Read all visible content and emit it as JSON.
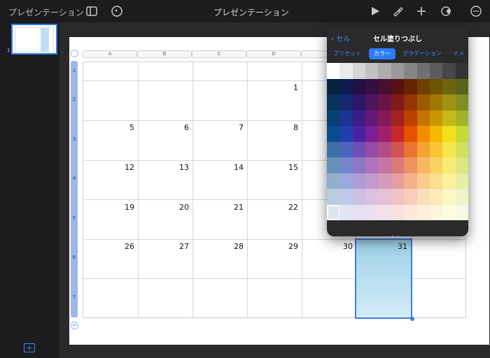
{
  "topbar": {
    "doc_title_left": "プレゼンテーション",
    "doc_title_center": "プレゼンテーション"
  },
  "sidebar": {
    "slide_number": "1",
    "add_label": "+"
  },
  "table": {
    "col_headers": [
      "A",
      "B",
      "C",
      "D"
    ],
    "row_labels": [
      "1",
      "2",
      "3",
      "4",
      "5",
      "6",
      "7"
    ],
    "days": [
      {
        "t": "1",
        "c": 4,
        "r": 1
      },
      {
        "t": "5",
        "c": 1,
        "r": 2
      },
      {
        "t": "6",
        "c": 2,
        "r": 2
      },
      {
        "t": "7",
        "c": 3,
        "r": 2
      },
      {
        "t": "8",
        "c": 4,
        "r": 2
      },
      {
        "t": "12",
        "c": 1,
        "r": 3
      },
      {
        "t": "13",
        "c": 2,
        "r": 3
      },
      {
        "t": "14",
        "c": 3,
        "r": 3
      },
      {
        "t": "15",
        "c": 4,
        "r": 3
      },
      {
        "t": "19",
        "c": 1,
        "r": 4
      },
      {
        "t": "20",
        "c": 2,
        "r": 4
      },
      {
        "t": "21",
        "c": 3,
        "r": 4
      },
      {
        "t": "22",
        "c": 4,
        "r": 4
      },
      {
        "t": "26",
        "c": 1,
        "r": 5
      },
      {
        "t": "27",
        "c": 2,
        "r": 5
      },
      {
        "t": "28",
        "c": 3,
        "r": 5
      },
      {
        "t": "29",
        "c": 4,
        "r": 5
      },
      {
        "t": "30",
        "c": 5,
        "r": 5
      },
      {
        "t": "31",
        "c": 6,
        "r": 5
      }
    ]
  },
  "popover": {
    "title": "セル塗りつぶし",
    "back_label": "セル",
    "tabs": [
      "プリセット",
      "カラー",
      "グラデーション",
      "イメ"
    ],
    "active_tab": "カラー",
    "gray_row": [
      "#ffffff",
      "#ebebeb",
      "#d6d6d6",
      "#c2c2c2",
      "#adadad",
      "#999999",
      "#858585",
      "#707070",
      "#5c5c5c",
      "#474747",
      "#333333",
      "#000000"
    ],
    "hue_columns": [
      "#0a4d8c",
      "#1f3fae",
      "#4a22a0",
      "#7a1f94",
      "#a0206a",
      "#c62828",
      "#e65100",
      "#f28c00",
      "#f6b800",
      "#f4df1f",
      "#c7d935",
      "#6fbf3a"
    ]
  }
}
